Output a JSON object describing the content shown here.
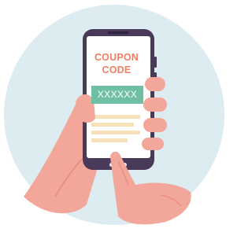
{
  "coupon": {
    "heading_line1": "COUPON",
    "heading_line2": "CODE",
    "code": "XXXXXX"
  },
  "colors": {
    "background_circle": "#dcecf0",
    "phone_body": "#4a3a5a",
    "phone_screen": "#ffffff",
    "accent_text": "#ef8064",
    "code_box": "#6fc0a3",
    "placeholder_lines": "#f6e1b8",
    "skin": "#f3a79a",
    "skin_dark": "#e98e82"
  },
  "icons": [
    "phone-illustration",
    "hand-illustration"
  ]
}
